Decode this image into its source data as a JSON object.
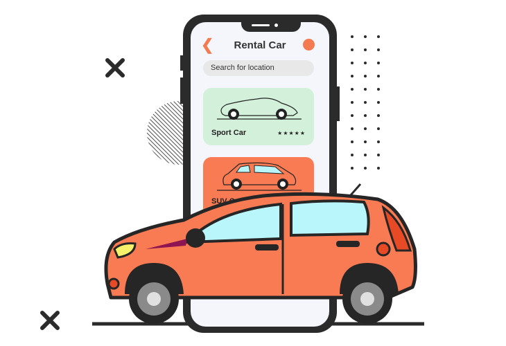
{
  "app": {
    "title": "Rental Car",
    "back_icon": "chevron-left-icon",
    "profile_icon": "orange-circle",
    "search_placeholder": "Search for location"
  },
  "cards": [
    {
      "label": "Sport Car",
      "rating": "★★★★★",
      "color": "#d3f0da"
    },
    {
      "label": "SUV Car",
      "color": "#f97b53"
    }
  ],
  "colors": {
    "accent": "#f47a50",
    "car_body": "#f97b53",
    "window": "#b9f6fb",
    "outline": "#262626"
  }
}
